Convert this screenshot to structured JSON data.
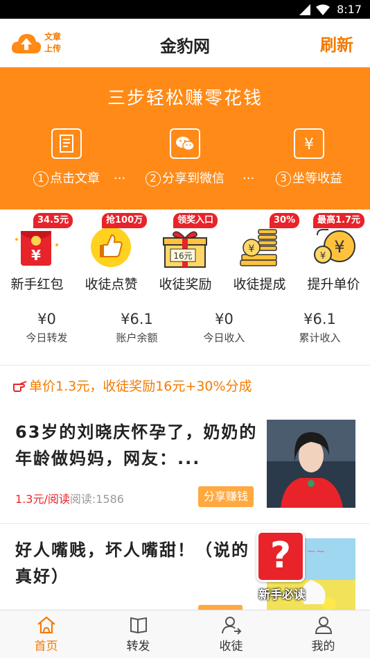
{
  "status_bar": {
    "time": "8:17"
  },
  "header": {
    "upload_label_line1": "文章",
    "upload_label_line2": "上传",
    "title": "金豹网",
    "refresh_label": "刷新"
  },
  "banner": {
    "title": "三步轻松赚零花钱",
    "steps": [
      {
        "num": "1",
        "label": "点击文章",
        "icon": "article-list-icon"
      },
      {
        "num": "2",
        "label": "分享到微信",
        "icon": "wechat-icon"
      },
      {
        "num": "3",
        "label": "坐等收益",
        "icon": "yen-icon"
      }
    ],
    "dots": "···"
  },
  "features": [
    {
      "label": "新手红包",
      "badge": "34.5元",
      "icon": "red-envelope-icon"
    },
    {
      "label": "收徒点赞",
      "badge": "抢100万",
      "icon": "thumbs-up-icon"
    },
    {
      "label": "收徒奖励",
      "badge": "领奖入口",
      "icon": "gift-box-icon",
      "gift_text": "16元"
    },
    {
      "label": "收徒提成",
      "badge": "30%",
      "icon": "coin-stack-icon"
    },
    {
      "label": "提升单价",
      "badge": "最高1.7元",
      "icon": "gold-coins-icon"
    }
  ],
  "stats": [
    {
      "value": "¥0",
      "caption": "今日转发"
    },
    {
      "value": "¥6.1",
      "caption": "账户余额"
    },
    {
      "value": "¥0",
      "caption": "今日收入"
    },
    {
      "value": "¥6.1",
      "caption": "累计收入"
    }
  ],
  "tip": "单价1.3元，收徒奖励16元+30%分成",
  "articles": [
    {
      "title": "63岁的刘晓庆怀孕了，奶奶的年龄做妈妈，网友：...",
      "price": "1.3元/阅读",
      "reads": "阅读:1586",
      "share_label": "分享赚钱"
    },
    {
      "title": "好人嘴贱，坏人嘴甜！（说的真好）",
      "share_label": ""
    }
  ],
  "guide_float": {
    "label": "新手必读",
    "symbol": "?"
  },
  "tabs": [
    {
      "label": "首页",
      "icon": "home-icon",
      "active": true
    },
    {
      "label": "转发",
      "icon": "book-icon",
      "active": false
    },
    {
      "label": "收徒",
      "icon": "add-user-icon",
      "active": false
    },
    {
      "label": "我的",
      "icon": "person-icon",
      "active": false
    }
  ],
  "colors": {
    "accent": "#ff8a17",
    "brand_text": "#f47a00",
    "badge": "#e8232a",
    "share_button": "#ffa940"
  }
}
